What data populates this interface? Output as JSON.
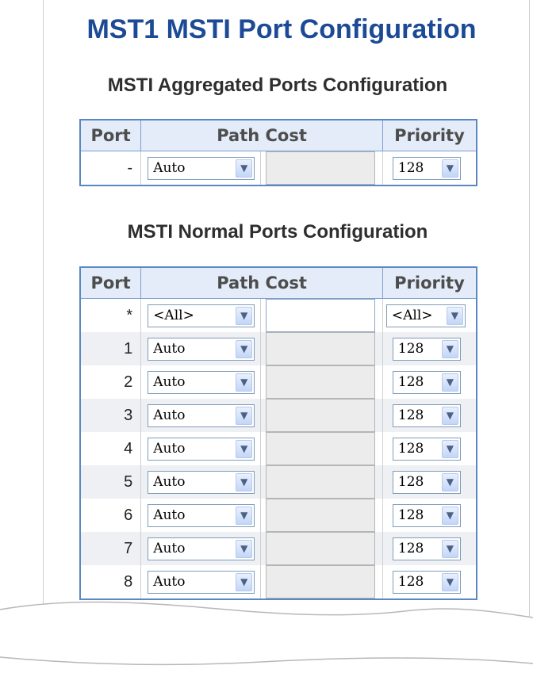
{
  "page": {
    "title": "MST1 MSTI Port Configuration",
    "aggregated_heading": "MSTI Aggregated Ports Configuration",
    "normal_heading": "MSTI Normal Ports Configuration"
  },
  "columns": {
    "port": "Port",
    "path_cost": "Path Cost",
    "priority": "Priority"
  },
  "aggregated": {
    "port": "-",
    "path_cost": "Auto",
    "priority": "128"
  },
  "normal": {
    "all_row": {
      "port": "*",
      "path_cost": "<All>",
      "priority": "<All>"
    },
    "rows": [
      {
        "port": "1",
        "path_cost": "Auto",
        "priority": "128"
      },
      {
        "port": "2",
        "path_cost": "Auto",
        "priority": "128"
      },
      {
        "port": "3",
        "path_cost": "Auto",
        "priority": "128"
      },
      {
        "port": "4",
        "path_cost": "Auto",
        "priority": "128"
      },
      {
        "port": "5",
        "path_cost": "Auto",
        "priority": "128"
      },
      {
        "port": "6",
        "path_cost": "Auto",
        "priority": "128"
      },
      {
        "port": "7",
        "path_cost": "Auto",
        "priority": "128"
      },
      {
        "port": "8",
        "path_cost": "Auto",
        "priority": "128"
      }
    ]
  },
  "icons": {
    "dropdown": "chevron-down-icon"
  },
  "colors": {
    "title": "#1c4a96",
    "table_border": "#5b88c2",
    "header_bg": "#e3ecf8",
    "row_alt": "#eef0f3"
  }
}
